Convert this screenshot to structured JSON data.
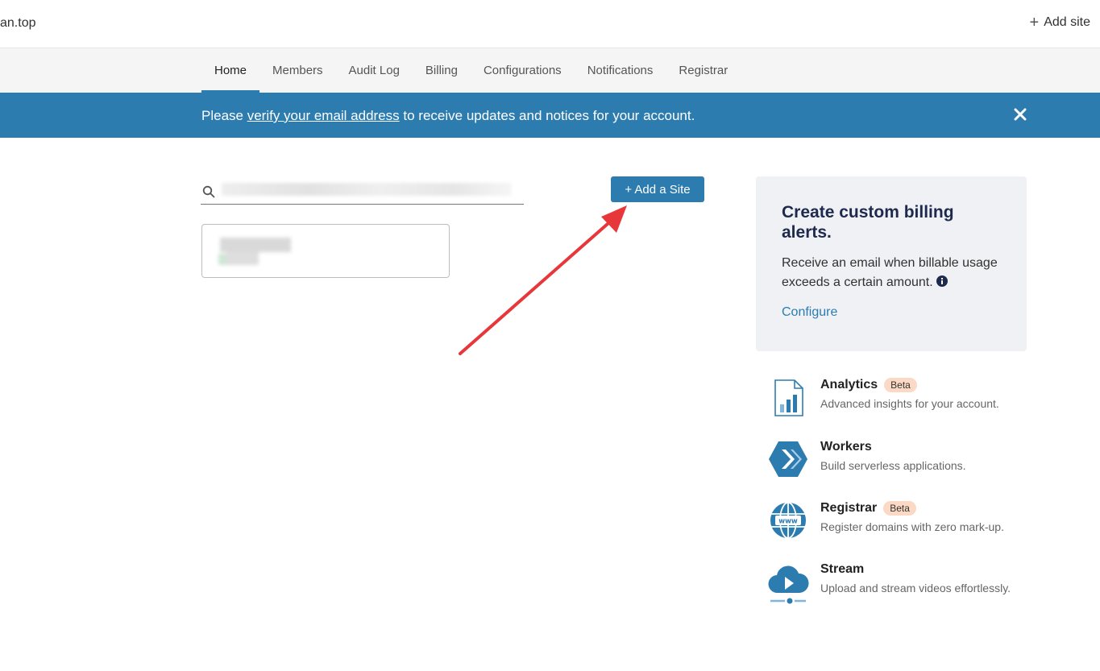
{
  "topbar": {
    "account_name": "an.top",
    "add_site_label": "Add site"
  },
  "tabs": [
    {
      "label": "Home",
      "active": true
    },
    {
      "label": "Members"
    },
    {
      "label": "Audit Log"
    },
    {
      "label": "Billing"
    },
    {
      "label": "Configurations"
    },
    {
      "label": "Notifications"
    },
    {
      "label": "Registrar"
    }
  ],
  "banner": {
    "prefix": "Please ",
    "link_text": "verify your email address",
    "suffix": " to receive updates and notices for your account."
  },
  "search": {
    "value": ""
  },
  "add_site_button": {
    "label": "+ Add a Site"
  },
  "billing_card": {
    "title": "Create custom billing alerts.",
    "description": "Receive an email when billable usage exceeds a certain amount.",
    "link": "Configure"
  },
  "products": [
    {
      "title": "Analytics",
      "badge": "Beta",
      "description": "Advanced insights for your account.",
      "icon": "analytics-icon"
    },
    {
      "title": "Workers",
      "badge": "",
      "description": "Build serverless applications.",
      "icon": "workers-icon"
    },
    {
      "title": "Registrar",
      "badge": "Beta",
      "description": "Register domains with zero mark-up.",
      "icon": "registrar-globe-icon"
    },
    {
      "title": "Stream",
      "badge": "",
      "description": "Upload and stream videos effortlessly.",
      "icon": "stream-icon"
    }
  ],
  "colors": {
    "accent": "#2c7cb0",
    "badge_bg": "#fbd9c4",
    "card_bg": "#f0f1f5",
    "arrow": "#e8373a"
  }
}
